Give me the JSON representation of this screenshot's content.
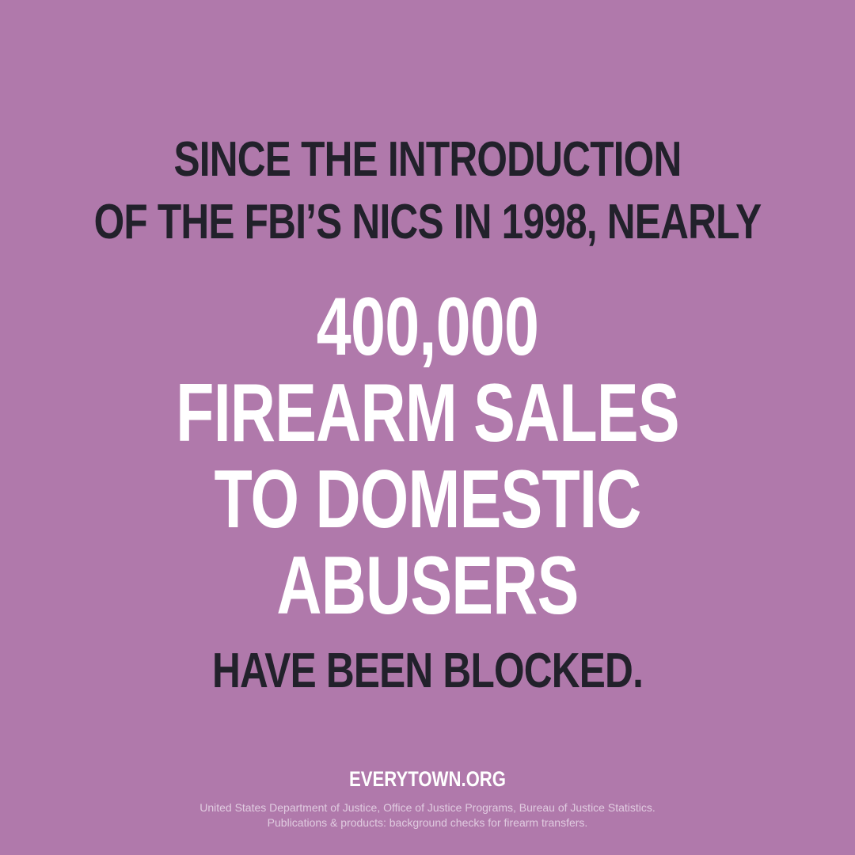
{
  "intro": {
    "line1": "SINCE THE INTRODUCTION",
    "line2": "OF THE FBI’S NICS IN 1998, NEARLY"
  },
  "highlight": {
    "line1": "400,000",
    "line2": "FIREARM SALES",
    "line3": "TO DOMESTIC",
    "line4": "ABUSERS"
  },
  "closing": "HAVE BEEN BLOCKED.",
  "website": "EVERYTOWN.ORG",
  "source": {
    "line1": "United States Department of Justice, Office of Justice Programs, Bureau of Justice Statistics.",
    "line2": "Publications & products: background checks for firearm transfers."
  },
  "colors": {
    "background": "#b079ab",
    "dark_text": "#22212b",
    "light_text": "#ffffff"
  }
}
